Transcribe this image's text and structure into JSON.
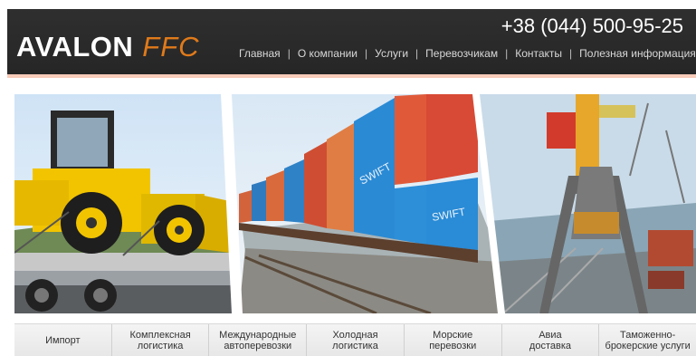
{
  "header": {
    "logo_main": "AVALON",
    "logo_accent": "FFC",
    "phone": "+38 (044) 500-95-25",
    "accent_color": "#e07a1a",
    "nav": [
      {
        "label": "Главная"
      },
      {
        "label": "О компании"
      },
      {
        "label": "Услуги"
      },
      {
        "label": "Перевозчикам"
      },
      {
        "label": "Контакты"
      },
      {
        "label": "Полезная информация"
      }
    ]
  },
  "banner": {
    "container_labels": [
      "SWIFT",
      "SWIFT"
    ]
  },
  "services": [
    {
      "line1": "Импорт",
      "line2": ""
    },
    {
      "line1": "Комплексная",
      "line2": "логистика"
    },
    {
      "line1": "Международные",
      "line2": "автоперевозки"
    },
    {
      "line1": "Холодная",
      "line2": "логистика"
    },
    {
      "line1": "Морские",
      "line2": "перевозки"
    },
    {
      "line1": "Авиа",
      "line2": "доставка"
    },
    {
      "line1": "Таможенно-",
      "line2": "брокерские услуги"
    }
  ]
}
